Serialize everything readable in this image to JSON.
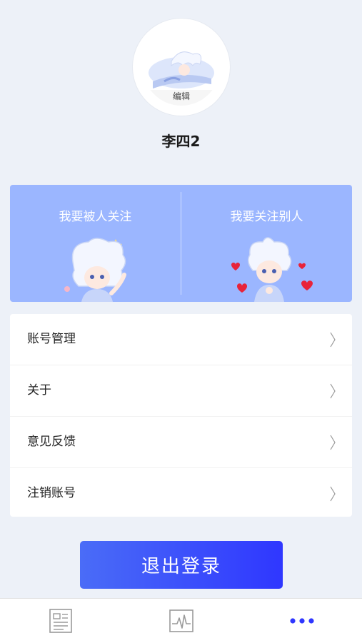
{
  "profile": {
    "edit_label": "编辑",
    "username": "李四2"
  },
  "follow": {
    "left_label": "我要被人关注",
    "right_label": "我要关注别人"
  },
  "menu": {
    "items": [
      {
        "label": "账号管理"
      },
      {
        "label": "关于"
      },
      {
        "label": "意见反馈"
      },
      {
        "label": "注销账号"
      }
    ]
  },
  "logout": {
    "label": "退出登录"
  },
  "tabbar": {
    "tabs": [
      {
        "icon": "news-icon",
        "active": false
      },
      {
        "icon": "activity-chart-icon",
        "active": false
      },
      {
        "icon": "more-icon",
        "active": true
      }
    ]
  },
  "colors": {
    "background": "#edf1f8",
    "panel": "#9bb6ff",
    "accent": "#2f37ff",
    "gradient_start": "#4a6cf7"
  }
}
